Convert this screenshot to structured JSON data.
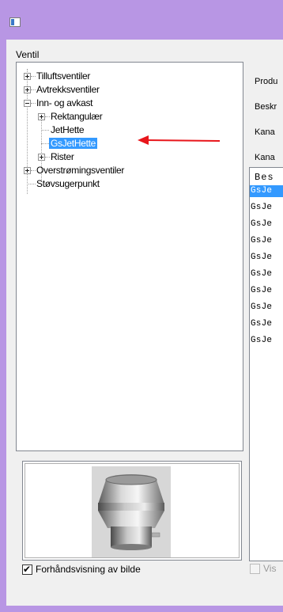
{
  "window": {
    "icon": "window-icon"
  },
  "valve_group": {
    "label": "Ventil"
  },
  "tree": {
    "items": [
      {
        "label": "Tilluftsventiler"
      },
      {
        "label": "Avtrekksventiler"
      },
      {
        "label": "Inn- og avkast"
      },
      {
        "label": "Rektangulær"
      },
      {
        "label": "JetHette"
      },
      {
        "label": "GsJetHette"
      },
      {
        "label": "Rister"
      },
      {
        "label": "Overstrømingsventiler"
      },
      {
        "label": "Støvsugerpunkt"
      }
    ]
  },
  "preview": {
    "checkbox_label": "Forhåndsvisning av bilde",
    "checked": true
  },
  "right_panel": {
    "labels": [
      "Produ",
      "Beskr",
      "Kana",
      "Kana"
    ],
    "list_header": "Bes",
    "rows": [
      "GsJe",
      "GsJe",
      "GsJe",
      "GsJe",
      "GsJe",
      "GsJe",
      "GsJe",
      "GsJe",
      "GsJe",
      "GsJe"
    ],
    "bottom_checkbox_label": "Vis"
  },
  "colors": {
    "accent": "#3399ff",
    "title_bar": "#b896e4",
    "annotation_arrow": "#e8161b"
  }
}
